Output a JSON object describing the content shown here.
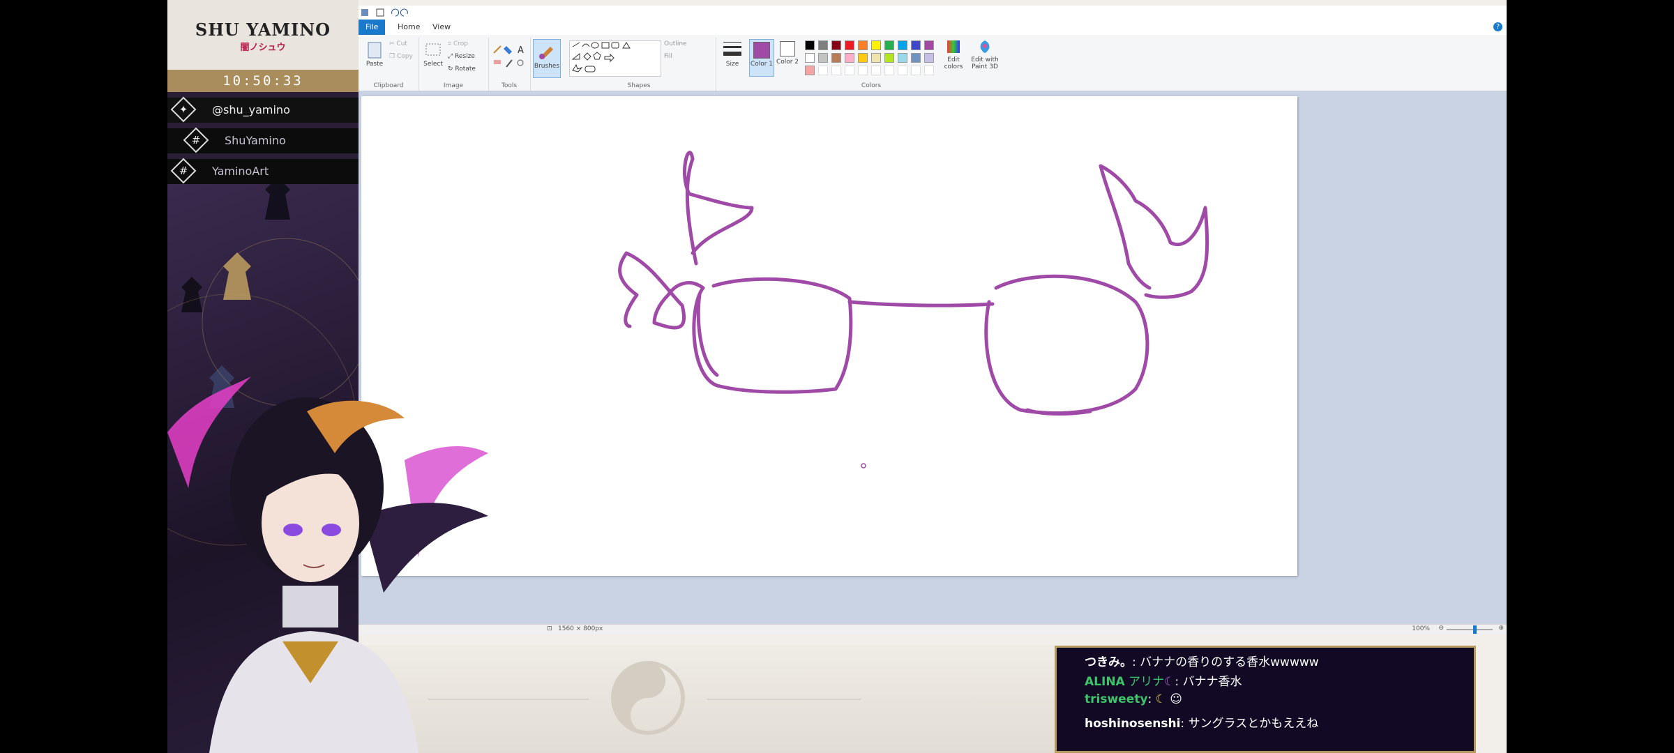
{
  "overlay": {
    "logo_title": "SHU YAMINO",
    "logo_subtitle": "闇ノシュウ",
    "clock": "10:50:33",
    "socials": [
      {
        "icon": "twitter-bird-icon",
        "label": "@shu_yamino"
      },
      {
        "icon": "hashtag-icon",
        "label": "ShuYamino"
      },
      {
        "icon": "hashtag-icon",
        "label": "YaminoArt"
      }
    ]
  },
  "paint": {
    "menu": {
      "file": "File",
      "home": "Home",
      "view": "View"
    },
    "ribbon": {
      "clipboard": {
        "group": "Clipboard",
        "paste": "Paste",
        "cut": "Cut",
        "copy": "Copy"
      },
      "image": {
        "group": "Image",
        "select": "Select",
        "crop": "Crop",
        "resize": "Resize",
        "rotate": "Rotate"
      },
      "tools": {
        "group": "Tools"
      },
      "brushes": "Brushes",
      "shapes": {
        "group": "Shapes",
        "outline": "Outline",
        "fill": "Fill"
      },
      "size": "Size",
      "color1": "Color 1",
      "color2": "Color 2",
      "colors_group": "Colors",
      "edit_colors": "Edit colors",
      "edit_paint3d": "Edit with Paint 3D"
    },
    "palette_top": [
      "#000000",
      "#7f7f7f",
      "#880015",
      "#ed1c24",
      "#ff7f27",
      "#fff200",
      "#22b14c",
      "#00a2e8",
      "#3f48cc",
      "#a349a4"
    ],
    "palette_mid": [
      "#ffffff",
      "#c3c3c3",
      "#b97a57",
      "#ffaec9",
      "#ffc90e",
      "#efe4b0",
      "#b5e61d",
      "#99d9ea",
      "#7092be",
      "#c8bfe7"
    ],
    "palette_bottom": [
      "#f5a3a3"
    ],
    "stroke_color": "#a04aa8",
    "status": {
      "size": "1560 × 800px",
      "zoom": "100%"
    }
  },
  "chat": [
    {
      "name": "つきみ。",
      "name_color": "#ffffff",
      "sep": ": ",
      "text": "バナナの香りのする香水wwwww"
    },
    {
      "name": "ALINA",
      "name_color": "#3ec46a",
      "extra": "アリナ",
      "sep": ": ",
      "text": "バナナ香水"
    },
    {
      "name": "trisweety",
      "name_color": "#3ec46a",
      "sep": ": ",
      "text": ""
    },
    {
      "name": "hoshinosenshi",
      "name_color": "#ffffff",
      "sep": ": ",
      "text": "サングラスとかもええね"
    }
  ]
}
